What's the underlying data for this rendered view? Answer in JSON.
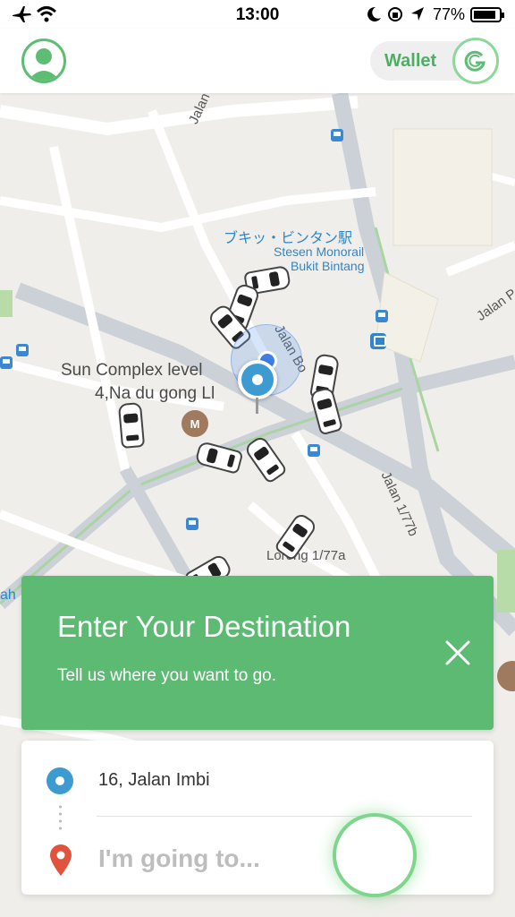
{
  "status_bar": {
    "time": "13:00",
    "battery_percent": "77%",
    "icons": [
      "airplane-icon",
      "wifi-icon",
      "moon-icon",
      "orientation-lock-icon",
      "location-arrow-icon",
      "battery-icon"
    ]
  },
  "header": {
    "avatar_icon": "user-avatar-icon",
    "wallet_label": "Wallet",
    "wallet_icon": "grab-g-icon",
    "accent_color": "#5dbd73"
  },
  "map": {
    "labels": {
      "station_jp": "ブキッ・ビンタン駅",
      "station_ms_1": "Stesen Monorail",
      "station_ms_2": "Bukit Bintang",
      "sun_complex_1": "Sun Complex level",
      "sun_complex_2": "4,Na du gong Ll",
      "jalan_bo": "Jalan Bo",
      "jalan_p_top": "Jalan P",
      "jalan_p_right": "Jalan P",
      "jalan_177b": "Jalan 1/77b",
      "lorong": "Lorong 1/77a",
      "museum_icon_text": "M",
      "edge_left_1": "ah"
    },
    "icons": [
      "car-icon",
      "location-pin-icon",
      "museum-icon",
      "bus-stop-icon",
      "monorail-icon"
    ]
  },
  "destination_banner": {
    "title": "Enter Your Destination",
    "subtitle": "Tell us where you want to go.",
    "close_icon": "close-icon",
    "color": "#5dba72"
  },
  "route_card": {
    "pickup_address": "16, Jalan Imbi",
    "dropoff_placeholder": "I'm going to...",
    "pickup_icon": "pickup-dot-icon",
    "dropoff_icon": "dropoff-pin-icon",
    "dropoff_color": "#e0533d"
  },
  "go_button": {
    "icon": "go-circle-icon"
  }
}
